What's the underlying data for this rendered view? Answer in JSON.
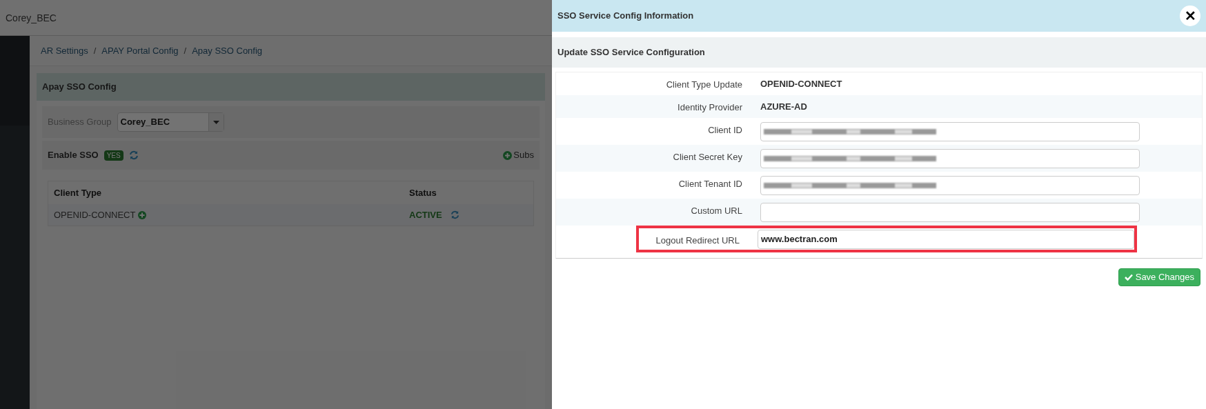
{
  "top_bar": {
    "title": "Corey_BEC"
  },
  "breadcrumbs": [
    "AR Settings",
    "APAY Portal Config",
    "Apay SSO Config"
  ],
  "breadcrumb_separators": [
    "/",
    "/"
  ],
  "panel": {
    "title": "Apay SSO Config",
    "business_group": {
      "label": "Business Group",
      "value": "Corey_BEC"
    },
    "enable_sso": {
      "label": "Enable SSO",
      "badge": "YES"
    },
    "subscribe_link": "Subs",
    "table": {
      "columns": [
        "Client Type",
        "Status"
      ],
      "rows": [
        {
          "client_type": "OPENID-CONNECT",
          "status": "ACTIVE"
        }
      ]
    }
  },
  "modal": {
    "title": "SSO Service Config Information",
    "close": "✕",
    "section_title": "Update SSO Service Configuration",
    "rows": [
      {
        "kind": "text",
        "label": "Client Type Update",
        "value": "OPENID-CONNECT",
        "highlighted": false
      },
      {
        "kind": "text",
        "label": "Identity Provider",
        "value": "AZURE-AD",
        "highlighted": false
      },
      {
        "kind": "field",
        "label": "Client ID",
        "blurred": true,
        "highlighted": false
      },
      {
        "kind": "field",
        "label": "Client Secret Key",
        "blurred": true,
        "highlighted": false
      },
      {
        "kind": "field",
        "label": "Client Tenant ID",
        "blurred": true,
        "highlighted": false
      },
      {
        "kind": "field",
        "label": "Custom URL",
        "blurred": false,
        "highlighted": false
      },
      {
        "kind": "field",
        "label": "Logout Redirect URL",
        "value": "www.bectran.com",
        "blurred": false,
        "highlighted": true
      }
    ],
    "save_button": "Save Changes"
  }
}
